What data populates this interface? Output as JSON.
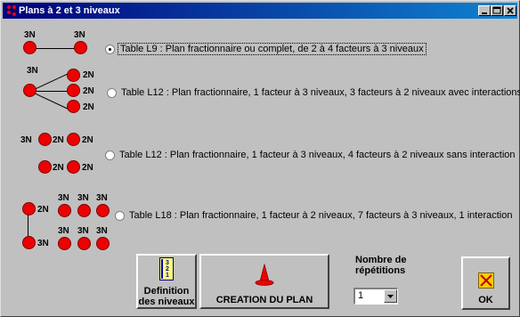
{
  "window": {
    "title": "Plans à 2 et 3 niveaux"
  },
  "diagrams": {
    "l9": {
      "a": "3N",
      "b": "3N"
    },
    "l12a": {
      "root": "3N",
      "c1": "2N",
      "c2": "2N",
      "c3": "2N"
    },
    "l12b": {
      "r1a": "3N",
      "r1b": "2N",
      "r1c": "2N",
      "r2a": "2N",
      "r2b": "2N"
    },
    "l18": {
      "left": "2N",
      "bottom": "3N",
      "t1": "3N",
      "t2": "3N",
      "t3": "3N",
      "b1": "3N",
      "b2": "3N",
      "b3": "3N"
    }
  },
  "options": [
    {
      "label": "Table L9 : Plan  fractionnaire ou complet, de 2 à 4 facteurs à 3 niveaux",
      "checked": true
    },
    {
      "label": "Table L12 : Plan fractionnaire, 1 facteur à 3 niveaux, 3 facteurs à 2 niveaux avec interactions",
      "checked": false
    },
    {
      "label": "Table L12 : Plan fractionnaire, 1 facteur à 3 niveaux, 4 facteurs à 2 niveaux sans interaction",
      "checked": false
    },
    {
      "label": "Table L18 : Plan fractionnaire, 1 facteur à 2 niveaux, 7 facteurs à 3 niveaux, 1 interaction",
      "checked": false
    }
  ],
  "buttons": {
    "definition_line1": "Definition",
    "definition_line2": "des niveaux",
    "definition_icon_digits": [
      "3",
      "2",
      "1"
    ],
    "creation": "CREATION DU PLAN",
    "ok": "OK"
  },
  "repetitions": {
    "label_line1": "Nombre de",
    "label_line2": "répétitions",
    "value": "1"
  },
  "colors": {
    "node": "#ee0000",
    "titlebar_start": "#00007b",
    "titlebar_end": "#1084d0"
  }
}
